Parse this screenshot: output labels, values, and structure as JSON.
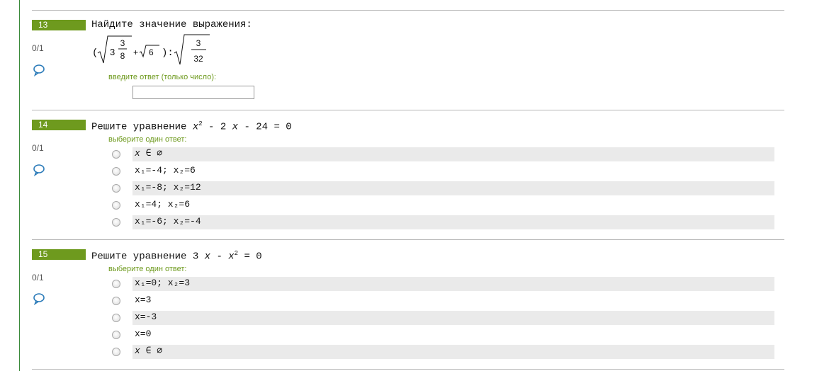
{
  "questions": [
    {
      "number": "13",
      "score": "0/1",
      "prompt": "Найдите значение выражения:",
      "hint": "введите ответ (только число):",
      "expr": {
        "open_paren": "(",
        "whole": "3",
        "frac_num": "3",
        "frac_den": "8",
        "plus": "+",
        "sqrt6": "6",
        "close_div": "):",
        "frac2_num": "3",
        "frac2_den": "32"
      },
      "answer_value": ""
    },
    {
      "number": "14",
      "score": "0/1",
      "prompt": "Решите уравнение",
      "eq": {
        "x": "x",
        "sup": "2",
        "rest": " - 2 ",
        "x2": "x",
        "tail": " - 24 = 0"
      },
      "hint": "выберите один ответ:",
      "options": [
        "x ∈ ∅",
        "x₁=-4;  x₂=6",
        "x₁=-8;  x₂=12",
        "x₁=4;  x₂=6",
        "x₁=-6;  x₂=-4"
      ]
    },
    {
      "number": "15",
      "score": "0/1",
      "prompt": "Решите уравнение",
      "eq": {
        "lead": "3 ",
        "x": "x",
        "minus": " - ",
        "x2": "x",
        "sup": "2",
        "tail": " = 0"
      },
      "hint": "выберите один ответ:",
      "options": [
        "x₁=0;  x₂=3",
        "x=3",
        "x=-3",
        "x=0",
        "x ∈ ∅"
      ]
    }
  ],
  "colors": {
    "badge": "#6e9a1e",
    "hint": "#6e9a1e",
    "comment_icon": "#2b7bb9",
    "rule": "#b7b7b7"
  },
  "icons": {
    "comment": "speech-bubble-icon",
    "radio": "radio-button"
  }
}
